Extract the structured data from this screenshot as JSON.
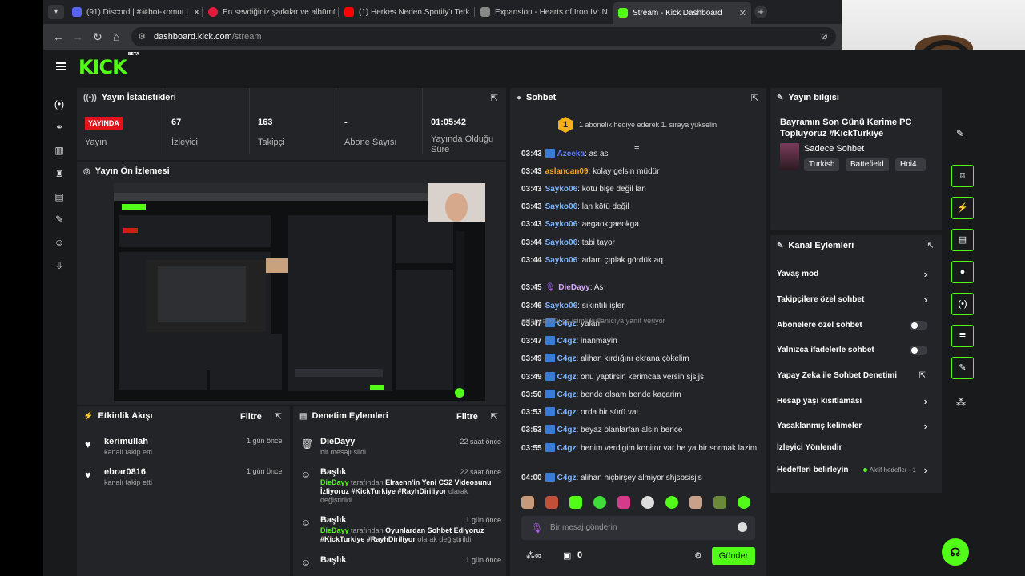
{
  "browser": {
    "tabs": [
      {
        "title": "(91) Discord | #☠bot-komut |",
        "color": "#5865f2"
      },
      {
        "title": "En sevdiğiniz şarkılar ve albümü",
        "color": "#e21b3c"
      },
      {
        "title": "(1) Herkes Neden Spotify'ı Terk",
        "color": "#ff0000"
      },
      {
        "title": "Expansion - Hearts of Iron IV: N",
        "color": "#888888"
      },
      {
        "title": "Stream - Kick Dashboard",
        "color": "#53fc18"
      }
    ],
    "url_host": "dashboard.kick.com",
    "url_path": "/stream"
  },
  "app": {
    "logo": "KICK",
    "logo_beta": "BETA"
  },
  "stats_panel": {
    "title": "Yayın İstatistikleri",
    "live_badge": "YAYINDA",
    "stats": [
      {
        "value": "",
        "label": "Yayın"
      },
      {
        "value": "67",
        "label": "İzleyici"
      },
      {
        "value": "163",
        "label": "Takipçi"
      },
      {
        "value": "-",
        "label": "Abone Sayısı"
      },
      {
        "value": "01:05:42",
        "label": "Yayında Olduğu Süre"
      }
    ]
  },
  "preview_panel": {
    "title": "Yayın Ön İzlemesi"
  },
  "activity_panel": {
    "title": "Etkinlik Akışı",
    "filter": "Filtre",
    "items": [
      {
        "name": "kerimullah",
        "sub": "kanalı takip etti",
        "when": "1 gün önce"
      },
      {
        "name": "ebrar0816",
        "sub": "kanalı takip etti",
        "when": "1 gün önce"
      }
    ]
  },
  "mod_panel": {
    "title": "Denetim Eylemleri",
    "filter": "Filtre",
    "items": [
      {
        "name": "DieDayy",
        "when": "22 saat önce",
        "desc_plain": "bir mesajı sildi"
      },
      {
        "name": "Başlık",
        "when": "22 saat önce",
        "actor": "DieDayy",
        "mid": "tarafından",
        "value": "Elraenn'in Yeni CS2 Videosunu İzliyoruz #KickTurkiye #RayhDiriliyor",
        "tail": "olarak değiştirildi"
      },
      {
        "name": "Başlık",
        "when": "1 gün önce",
        "actor": "DieDayy",
        "mid": "tarafından",
        "value": "Oyunlardan Sohbet Ediyoruz #KickTurkiye #RayhDiriliyor",
        "tail": "olarak değiştirildi"
      },
      {
        "name": "Başlık",
        "when": "1 gün önce"
      }
    ]
  },
  "chat_panel": {
    "title": "Sohbet",
    "gift_count": "1",
    "gift_text": "1 abonelik hediye ederek 1. sıraya yükselin",
    "messages": [
      {
        "time": "03:43",
        "user": "Azeeka",
        "color": "#5b7cf0",
        "text": "as as",
        "badge": true
      },
      {
        "time": "03:43",
        "user": "aslancan09",
        "color": "#f5a623",
        "text": "kolay gelsin müdür",
        "badge": false
      },
      {
        "time": "03:43",
        "user": "Sayko06",
        "color": "#7fb4ff",
        "text": "kötü bişe değil lan",
        "badge": false
      },
      {
        "time": "03:43",
        "user": "Sayko06",
        "color": "#7fb4ff",
        "text": "lan kötü değil",
        "badge": false
      },
      {
        "time": "03:43",
        "user": "Sayko06",
        "color": "#7fb4ff",
        "text": "aegaokgaeokga",
        "badge": false
      },
      {
        "time": "03:44",
        "user": "Sayko06",
        "color": "#7fb4ff",
        "text": "tabi tayor",
        "badge": false
      },
      {
        "time": "03:44",
        "user": "Sayko06",
        "color": "#7fb4ff",
        "text": "adam çıplak gördük aq",
        "badge": false
      },
      {
        "time": "03:45",
        "user": "DieDayy",
        "color": "#d7a6ff",
        "text": "As",
        "badge": false,
        "mic": true
      },
      {
        "time": "03:46",
        "user": "Sayko06",
        "color": "#7fb4ff",
        "text": "sıkıntılı işler",
        "badge": false
      },
      {
        "time": "03:47",
        "user": "C4gz",
        "color": "#7fb4ff",
        "text": "yalan",
        "badge": true
      },
      {
        "time": "03:47",
        "user": "C4gz",
        "color": "#7fb4ff",
        "text": "inanmayin",
        "badge": true
      },
      {
        "time": "03:49",
        "user": "C4gz",
        "color": "#7fb4ff",
        "text": "alihan kırdığını ekrana çökelim",
        "badge": true
      },
      {
        "time": "03:49",
        "user": "C4gz",
        "color": "#7fb4ff",
        "text": "onu yaptirsin kerimcaa versin sjsjjs",
        "badge": true
      },
      {
        "time": "03:50",
        "user": "C4gz",
        "color": "#7fb4ff",
        "text": "bende olsam bende kaçarim",
        "badge": true
      },
      {
        "time": "03:53",
        "user": "C4gz",
        "color": "#7fb4ff",
        "text": "orda bir sürü vat",
        "badge": true
      },
      {
        "time": "03:53",
        "user": "C4gz",
        "color": "#7fb4ff",
        "text": "beyaz olanlarfan alsın bence",
        "badge": true
      },
      {
        "time": "03:55",
        "user": "C4gz",
        "color": "#7fb4ff",
        "text": "benim verdigim konitor var he ya bir sormak lazim",
        "badge": true
      },
      {
        "time": "04:00",
        "user": "C4gz",
        "color": "#7fb4ff",
        "text": "alihan hiçbirşey almiyor shjsbsisjis",
        "badge": true
      }
    ],
    "reply_note": "aslancan09: sa isimli kullanıcıya yanıt veriyor",
    "input_placeholder": "Bir mesaj gönderin",
    "footer_count": "0",
    "send_label": "Gönder"
  },
  "info_panel": {
    "title": "Yayın bilgisi",
    "stream_title": "Bayramın Son Günü Kerime PC Topluyoruz #KickTurkiye",
    "category": "Sadece Sohbet",
    "tags": [
      "Turkish",
      "Battefield",
      "Hoi4"
    ]
  },
  "channel_actions": {
    "title": "Kanal Eylemleri",
    "items": [
      {
        "label": "Yavaş mod",
        "kind": "chevron"
      },
      {
        "label": "Takipçilere özel sohbet",
        "kind": "chevron"
      },
      {
        "label": "Abonelere özel sohbet",
        "kind": "toggle"
      },
      {
        "label": "Yalnızca ifadelerle sohbet",
        "kind": "toggle"
      },
      {
        "label": "Yapay Zeka ile Sohbet Denetimi",
        "kind": "external"
      },
      {
        "label": "Hesap yaşı kısıtlaması",
        "kind": "chevron"
      },
      {
        "label": "Yasaklanmış kelimeler",
        "kind": "chevron"
      },
      {
        "label": "İzleyici Yönlendir",
        "kind": "none"
      },
      {
        "label": "Hedefleri belirleyin",
        "kind": "chevron",
        "goal": "Aktif hedefler - 1"
      }
    ]
  },
  "colors": {
    "accent": "#53fc18",
    "live": "#e0141a"
  }
}
